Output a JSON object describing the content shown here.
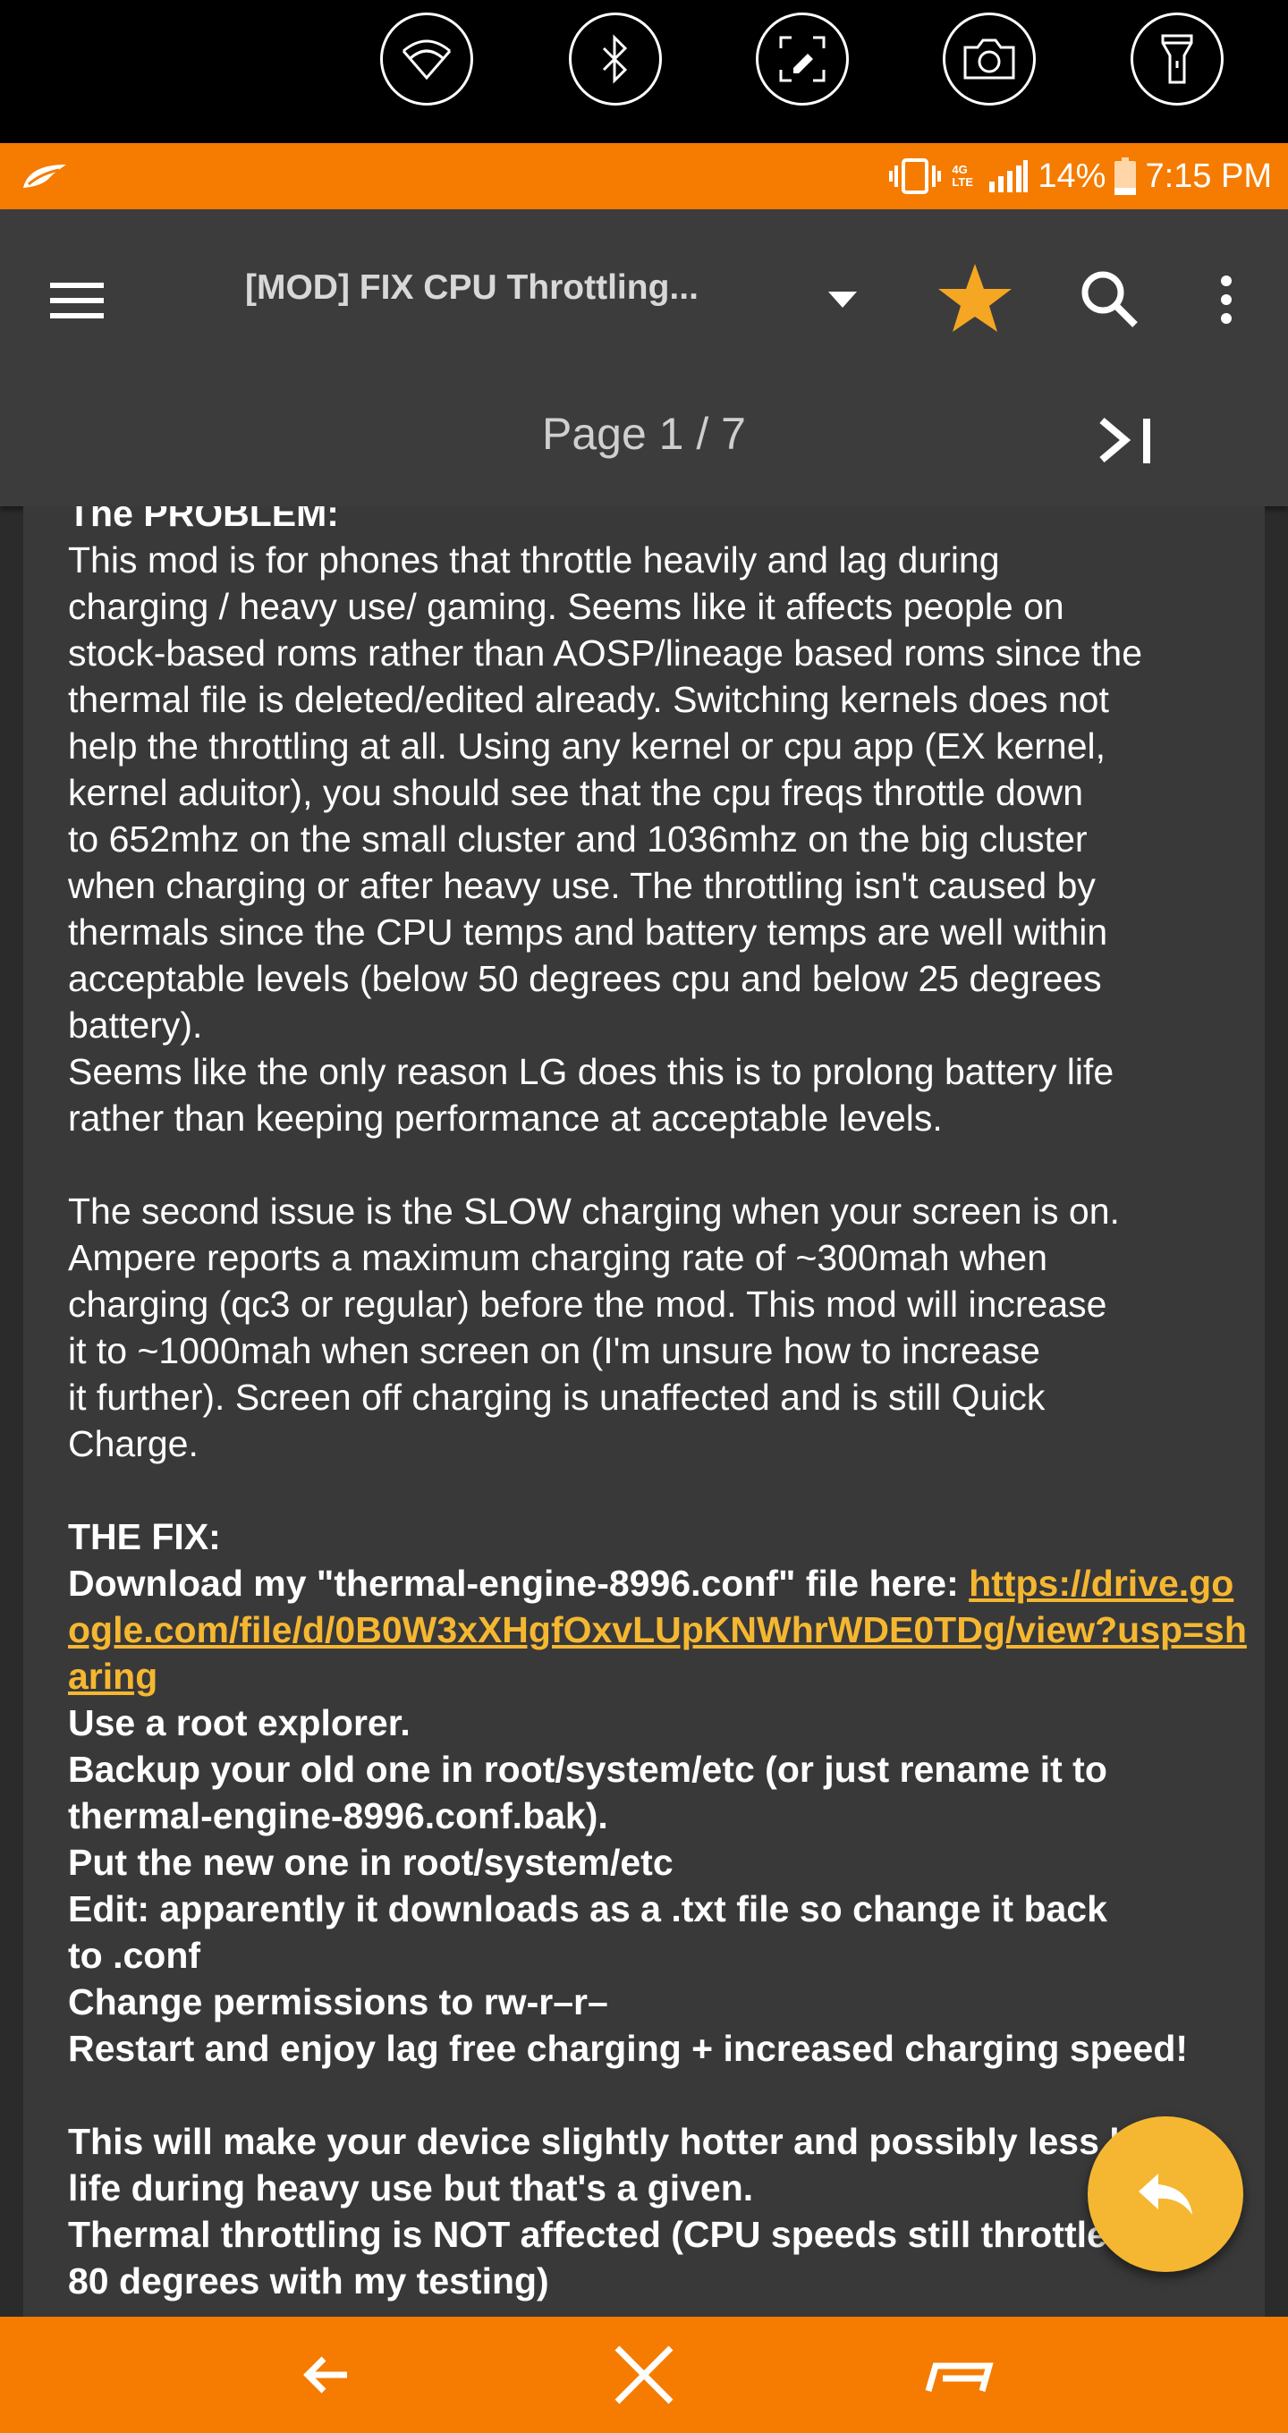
{
  "quick_settings": {
    "toggles": [
      "wifi-icon",
      "bluetooth-icon",
      "screen-capture-icon",
      "camera-icon",
      "flashlight-icon"
    ]
  },
  "status_bar": {
    "network": "4G LTE",
    "battery": "14%",
    "time": "7:15 PM",
    "icons": [
      "notification-leaf-icon",
      "vibrate-icon",
      "signal-icon",
      "battery-icon"
    ]
  },
  "toolbar": {
    "thread_title": "[MOD] FIX CPU Throttling...",
    "page_indicator": "Page 1 / 7",
    "icons": [
      "menu-icon",
      "dropdown-icon",
      "star-icon",
      "search-icon",
      "more-vert-icon",
      "last-page-icon"
    ]
  },
  "post": {
    "heading": "The PROBLEM:",
    "para1": "This mod is for phones that throttle heavily and lag during\ncharging / heavy use/ gaming. Seems like it affects people on\nstock-based roms rather than AOSP/lineage based roms since the\nthermal file is deleted/edited already. Switching kernels does not\nhelp the throttling at all. Using any kernel or cpu app (EX kernel,\nkernel aduitor), you should see that the cpu freqs throttle down\nto 652mhz on the small cluster and 1036mhz on the big cluster\nwhen charging or after heavy use. The throttling isn't caused by\nthermals since the CPU temps and battery temps are well within\nacceptable levels (below 50 degrees cpu and below 25 degrees\nbattery).",
    "para2": "Seems like the only reason LG does this is to prolong battery life\nrather than keeping performance at acceptable levels.",
    "para3": "The second issue is the SLOW charging when your screen is on.\nAmpere reports a maximum charging rate of ~300mah when\ncharging (qc3 or regular) before the mod. This mod will increase\nit to ~1000mah when screen on (I'm unsure how to increase\nit further). Screen off charging is unaffected and is still Quick\nCharge.",
    "fix_heading": "THE FIX:",
    "download_prefix": "Download my \"thermal-engine-8996.conf\" file here: ",
    "download_link": "https://drive.google.com/file/d/0B0W3xXHgfOxvLUpKNWhrWDE0TDg/view?usp=sharing",
    "step1": "Use a root explorer.",
    "step2": "Backup your old one in root/system/etc (or just rename it to\nthermal-engine-8996.conf.bak).",
    "step3": "Put the new one in root/system/etc",
    "step4": "Edit: apparently it downloads as a .txt file so change it back\nto .conf",
    "step5": "Change permissions to rw-r–r–",
    "step6": "Restart and enjoy lag free charging + increased charging speed!",
    "note1": "This will make your device slightly hotter and possibly less l\nlife during heavy use but that's a given.",
    "note2": "Thermal throttling is NOT affected (CPU speeds still throttle a\n80 degrees with my testing)"
  },
  "fab": {
    "icon": "reply-icon"
  },
  "nav_bar": {
    "icons": [
      "back-arrow-icon",
      "close-x-icon",
      "recents-icon"
    ]
  },
  "colors": {
    "accent_orange": "#f57c00",
    "link_yellow": "#f5b731",
    "star_yellow": "#f5a623",
    "appbar": "#3c3c3c",
    "content_bg": "#393939"
  }
}
